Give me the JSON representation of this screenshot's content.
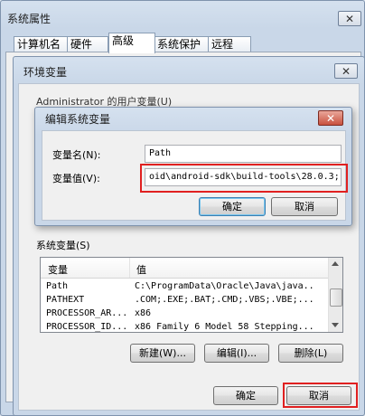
{
  "outer": {
    "title": "系统属性",
    "tabs": [
      "计算机名",
      "硬件",
      "高级",
      "系统保护",
      "远程"
    ],
    "close_glyph": "✕"
  },
  "env": {
    "title": "环境变量",
    "user_vars_label_partial": "Administrator 的用户变量(U)",
    "system_vars_label": "系统变量(S)",
    "columns": {
      "name": "变量",
      "value": "值"
    },
    "rows": [
      {
        "name": "Path",
        "value": "C:\\ProgramData\\Oracle\\Java\\java..."
      },
      {
        "name": "PATHEXT",
        "value": ".COM;.EXE;.BAT;.CMD;.VBS;.VBE;...."
      },
      {
        "name": "PROCESSOR_AR...",
        "value": "x86"
      },
      {
        "name": "PROCESSOR_ID...",
        "value": "x86 Family 6 Model 58 Stepping..."
      }
    ],
    "new_label": "新建(W)...",
    "edit_label": "编辑(I)...",
    "delete_label": "删除(L)",
    "ok_label": "确定",
    "cancel_label": "取消"
  },
  "edit": {
    "title": "编辑系统变量",
    "name_label": "变量名(N):",
    "value_label": "变量值(V):",
    "name_value": "Path",
    "value_value": "oid\\android-sdk\\build-tools\\28.0.3;",
    "ok_label": "确定",
    "cancel_label": "取消"
  },
  "colors": {
    "highlight_border": "#e02020",
    "default_button": "#3c7fb1"
  },
  "icons": {
    "close": "close-icon",
    "scroll_up": "chevron-up-icon",
    "scroll_down": "chevron-down-icon"
  }
}
